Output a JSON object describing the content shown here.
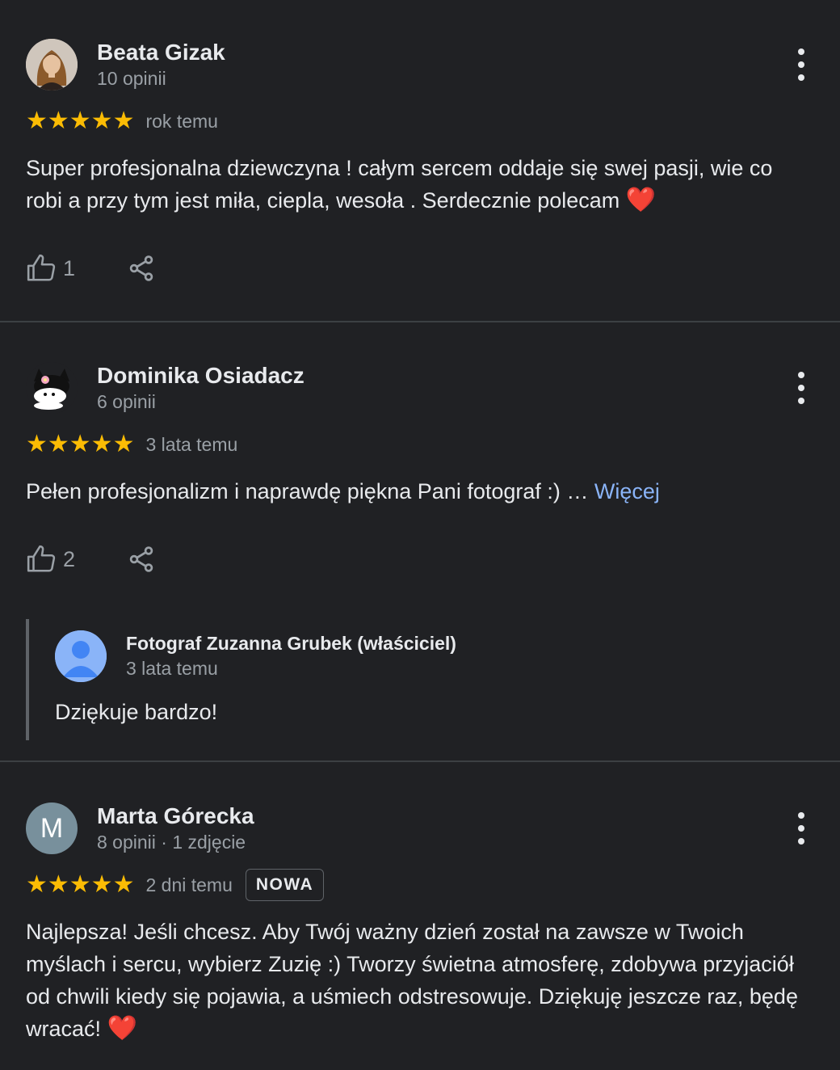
{
  "reviews": [
    {
      "name": "Beata Gizak",
      "meta": "10 opinii",
      "stars": "★★★★★",
      "time": "rok temu",
      "text": "Super profesjonalna dziewczyna ! całym sercem oddaje się swej pasji, wie co robi a przy tym jest miła, ciepla, wesoła . Serdecznie polecam",
      "likes": "1",
      "avatar": "photo-avatar"
    },
    {
      "name": "Dominika Osiadacz",
      "meta": "6 opinii",
      "stars": "★★★★★",
      "time": "3 lata temu",
      "text": "Pełen profesjonalizm i naprawdę piękna Pani fotograf :) …",
      "more": "Więcej",
      "likes": "2",
      "avatar": "kuromi-avatar",
      "reply": {
        "name": "Fotograf Zuzanna Grubek (właściciel)",
        "time": "3 lata temu",
        "text": "Dziękuje bardzo!"
      }
    },
    {
      "name": "Marta Górecka",
      "meta": "8 opinii · 1 zdjęcie",
      "stars": "★★★★★",
      "time": "2 dni temu",
      "badge": "NOWA",
      "text": "Najlepsza! Jeśli chcesz. Aby Twój ważny dzień został na zawsze w Twoich myślach i sercu, wybierz Zuzię :) Tworzy świetna atmosferę, zdobywa przyjaciół od chwili kiedy się pojawia, a uśmiech odstresowuje. Dziękuję jeszcze raz, będę wracać!",
      "avatar_letter": "M"
    }
  ],
  "colors": {
    "background": "#202124",
    "star": "#fbbc04",
    "link": "#8ab4f8",
    "divider": "#3c4043",
    "heart": "#e53935"
  },
  "icons": {
    "like": "thumb-up-icon",
    "share": "share-icon",
    "menu": "more-vert-icon",
    "heart": "heart-emoji",
    "owner": "person-icon"
  }
}
